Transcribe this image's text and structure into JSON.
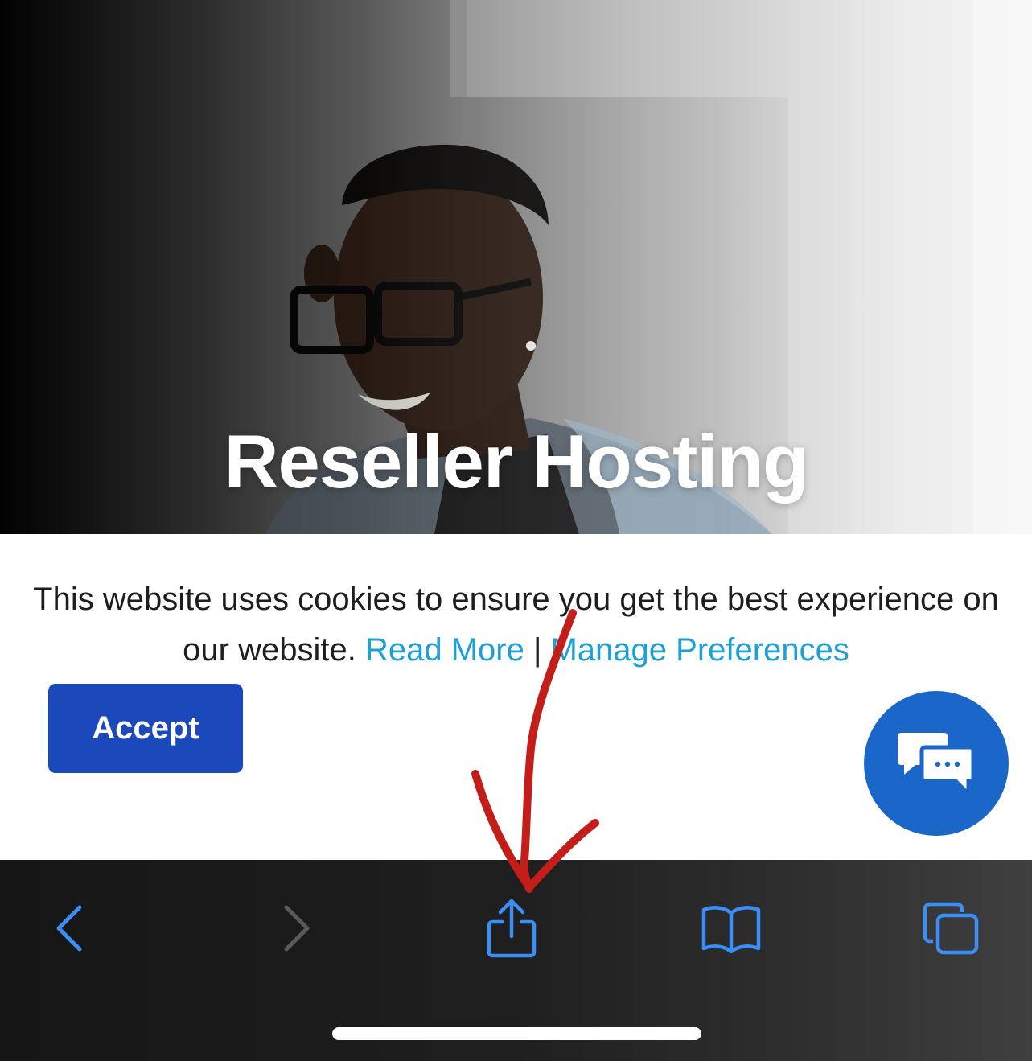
{
  "hero": {
    "title": "Reseller Hosting"
  },
  "cookie_banner": {
    "message": "This website uses cookies to ensure you get the best experience on our website.",
    "read_more_label": "Read More",
    "separator": "|",
    "manage_preferences_label": "Manage Preferences",
    "accept_label": "Accept",
    "link_color": "#1e9fd6",
    "accept_color": "#1b49bb"
  },
  "chat_widget": {
    "icon": "chat-bubbles-icon",
    "color": "#1a66c9"
  },
  "toolbar": {
    "buttons": [
      {
        "icon": "chevron-left-icon",
        "state": "enabled"
      },
      {
        "icon": "chevron-right-icon",
        "state": "disabled"
      },
      {
        "icon": "share-icon",
        "state": "enabled"
      },
      {
        "icon": "bookmarks-book-icon",
        "state": "enabled"
      },
      {
        "icon": "tabs-icon",
        "state": "enabled"
      }
    ],
    "accent_color": "#3a8ef5"
  },
  "annotation": {
    "type": "hand-drawn arrow",
    "color": "#c41e1a",
    "points_to": "share-icon"
  }
}
